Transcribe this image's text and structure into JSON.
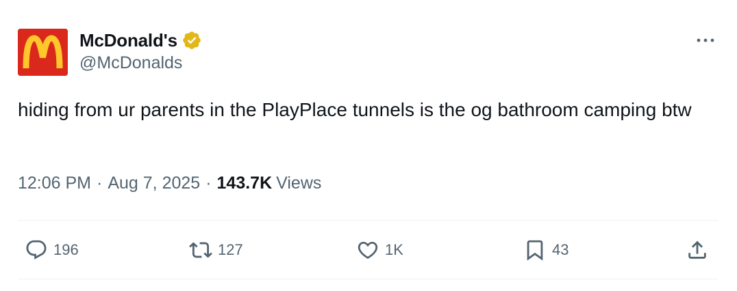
{
  "author": {
    "display_name": "McDonald's",
    "handle": "@McDonalds",
    "verified_badge_icon": "verified-badge-gold",
    "avatar_bg": "#da291c",
    "avatar_logo": "golden-arches"
  },
  "tweet": {
    "text": "hiding from ur parents in the PlayPlace tunnels is the og bathroom camping btw",
    "time": "12:06 PM",
    "date": "Aug 7, 2025",
    "separator": "·",
    "views_count": "143.7K",
    "views_label": "Views"
  },
  "actions": {
    "replies": "196",
    "reposts": "127",
    "likes": "1K",
    "bookmarks": "43"
  },
  "icons": {
    "more": "more-horizontal-icon",
    "reply": "reply-icon",
    "repost": "repost-icon",
    "like": "heart-icon",
    "bookmark": "bookmark-icon",
    "share": "share-icon"
  },
  "colors": {
    "text_primary": "#0f1419",
    "text_secondary": "#536471",
    "divider": "#eff3f4",
    "badge_gold": "#e2b719",
    "arches_yellow": "#ffc72c",
    "brand_red": "#da291c"
  }
}
